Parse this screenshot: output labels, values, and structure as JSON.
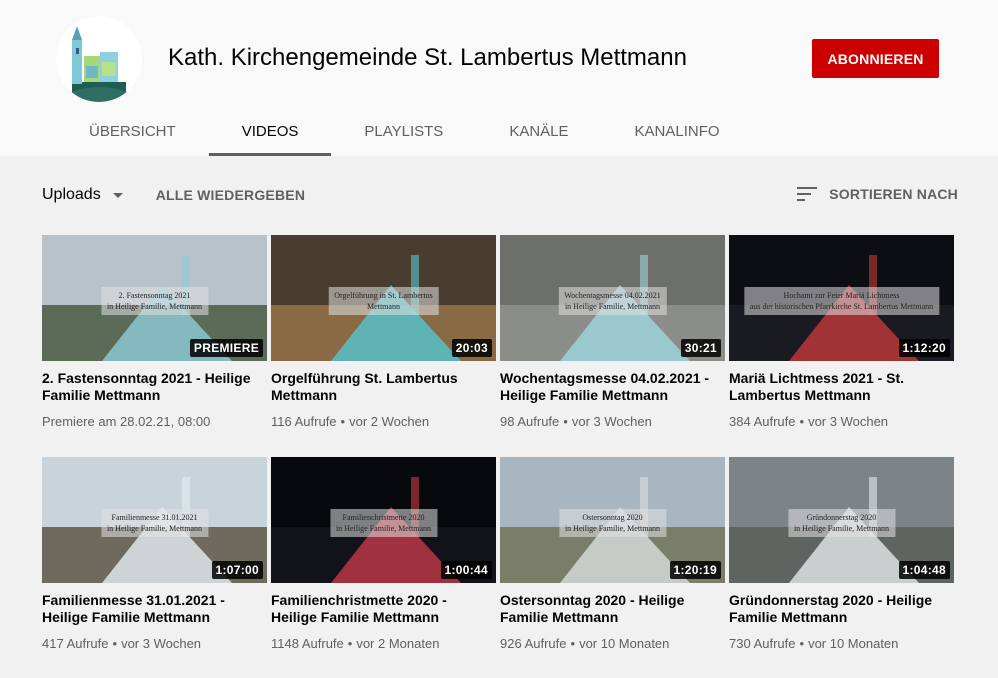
{
  "channel": {
    "name": "Kath. Kirchengemeinde St. Lambertus Mettmann",
    "subscribe_label": "ABONNIEREN"
  },
  "tabs": [
    {
      "label": "ÜBERSICHT",
      "active": false
    },
    {
      "label": "VIDEOS",
      "active": true
    },
    {
      "label": "PLAYLISTS",
      "active": false
    },
    {
      "label": "KANÄLE",
      "active": false
    },
    {
      "label": "KANALINFO",
      "active": false
    }
  ],
  "toolbar": {
    "uploads_label": "Uploads",
    "play_all_label": "ALLE WIEDERGEBEN",
    "sort_label": "SORTIEREN NACH"
  },
  "meta_separator": "•",
  "videos": [
    {
      "title": "2. Fastensonntag 2021 - Heilige Familie Mettmann",
      "badge": "PREMIERE",
      "views": "Premiere am 28.02.21, 08:00",
      "age": "",
      "overlay": [
        "2. Fastensonntag 2021",
        "in Heilige Familie, Mettmann"
      ],
      "sky": "#b9c2c9",
      "ground": "#5c6b57",
      "accent": "#8ecdd9"
    },
    {
      "title": "Orgelführung St. Lambertus Mettmann",
      "badge": "20:03",
      "views": "116 Aufrufe",
      "age": "vor 2 Wochen",
      "overlay": [
        "Orgelführung in St. Lambertus",
        "Mettmann"
      ],
      "sky": "#4a3d30",
      "ground": "#8a6a45",
      "accent": "#53c7cf"
    },
    {
      "title": "Wochentagsmesse 04.02.2021 - Heilige Familie Mettmann",
      "badge": "30:21",
      "views": "98 Aufrufe",
      "age": "vor 3 Wochen",
      "overlay": [
        "Wochentagsmesse 04.02.2021",
        "in Heilige Familie, Mettmann"
      ],
      "sky": "#6d6f6a",
      "ground": "#8a8d88",
      "accent": "#9fd6e0"
    },
    {
      "title": "Mariä Lichtmess 2021 - St. Lambertus Mettmann",
      "badge": "1:12:20",
      "views": "384 Aufrufe",
      "age": "vor 3 Wochen",
      "overlay": [
        "Hochamt zur Feier Mariä Lichtmess",
        "aus der historischen Pfarrkirche St. Lambertus Mettmann"
      ],
      "sky": "#0d0d14",
      "ground": "#1a1a22",
      "accent": "#c43a3a"
    },
    {
      "title": "Familienmesse 31.01.2021 - Heilige Familie Mettmann",
      "badge": "1:07:00",
      "views": "417 Aufrufe",
      "age": "vor 3 Wochen",
      "overlay": [
        "Familienmesse 31.01.2021",
        "in Heilige Familie, Mettmann"
      ],
      "sky": "#c9d3da",
      "ground": "#6e6a5e",
      "accent": "#e8eef2"
    },
    {
      "title": "Familienchristmette 2020 - Heilige Familie Mettmann",
      "badge": "1:00:44",
      "views": "1148 Aufrufe",
      "age": "vor 2 Monaten",
      "overlay": [
        "Familienchristmette 2020",
        "in Heilige Familie, Mettmann"
      ],
      "sky": "#08090c",
      "ground": "#111318",
      "accent": "#c43a4a"
    },
    {
      "title": "Ostersonntag 2020 - Heilige Familie Mettmann",
      "badge": "1:20:19",
      "views": "926 Aufrufe",
      "age": "vor 10 Monaten",
      "overlay": [
        "Ostersonntag 2020",
        "in Heilige Familie, Mettmann"
      ],
      "sky": "#a7b6c0",
      "ground": "#7a7d68",
      "accent": "#d9dedf"
    },
    {
      "title": "Gründonnerstag 2020 - Heilige Familie Mettmann",
      "badge": "1:04:48",
      "views": "730 Aufrufe",
      "age": "vor 10 Monaten",
      "overlay": [
        "Gründonnerstag 2020",
        "in Heilige Familie, Mettmann"
      ],
      "sky": "#7c8487",
      "ground": "#5e6560",
      "accent": "#e4e8ea"
    }
  ],
  "colors": {
    "brand_red": "#cc0000",
    "text_primary": "#030303",
    "text_secondary": "#606060"
  }
}
